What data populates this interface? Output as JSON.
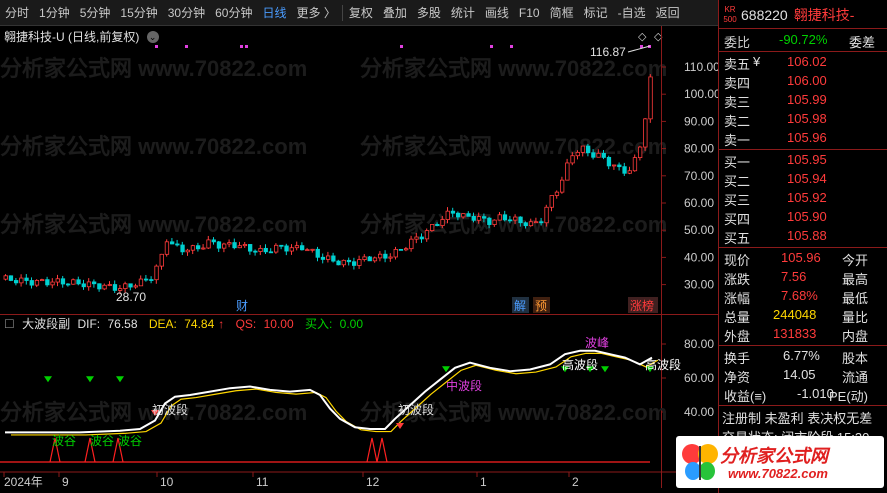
{
  "toolbar": {
    "items": [
      "分时",
      "1分钟",
      "5分钟",
      "15分钟",
      "30分钟",
      "60分钟",
      "日线",
      "更多 〉",
      "复权",
      "叠加",
      "多股",
      "统计",
      "画线",
      "F10",
      "简框",
      "标记",
      "-自选",
      "返回"
    ],
    "active": "日线",
    "corner": "⊞"
  },
  "main": {
    "title": "翱捷科技-U (日线,前复权)",
    "title_icon": "chevron-down-icon",
    "high_label": "116.87",
    "low_label": "28.70",
    "events": [
      "财",
      "解",
      "预",
      "涨榜"
    ],
    "price_ticks": [
      "110.00",
      "100.00",
      "90.00",
      "80.00",
      "70.00",
      "60.00",
      "50.00",
      "40.00",
      "30.00"
    ],
    "watermark": "分析家公式网 www.70822.com"
  },
  "indicator": {
    "name": "大波段副",
    "dif_label": "DIF:",
    "dif_value": "76.58",
    "dea_label": "DEA:",
    "dea_value": "74.84",
    "qs_label": "QS:",
    "qs_value": "10.00",
    "buy_label": "买入:",
    "buy_value": "0.00",
    "ticks": [
      "80.00",
      "60.00",
      "40.00"
    ],
    "annotations": [
      "波谷",
      "波谷",
      "波谷",
      "初波段",
      "初波段",
      "中波段",
      "高波段",
      "高波段",
      "波峰"
    ]
  },
  "xaxis": {
    "labels": [
      "2024年",
      "9",
      "10",
      "11",
      "12",
      "1",
      "2"
    ]
  },
  "quote": {
    "badge_top": "KR",
    "badge_bottom": "500",
    "code": "688220",
    "name": "翱捷科技-",
    "weibi_label": "委比",
    "weibi_value": "-90.72%",
    "weicha_label": "委差",
    "asks": [
      {
        "label": "卖五",
        "price": "106.02",
        "mark": "¥"
      },
      {
        "label": "卖四",
        "price": "106.00"
      },
      {
        "label": "卖三",
        "price": "105.99"
      },
      {
        "label": "卖二",
        "price": "105.98"
      },
      {
        "label": "卖一",
        "price": "105.96"
      }
    ],
    "bids": [
      {
        "label": "买一",
        "price": "105.95"
      },
      {
        "label": "买二",
        "price": "105.94"
      },
      {
        "label": "买三",
        "price": "105.92"
      },
      {
        "label": "买四",
        "price": "105.90"
      },
      {
        "label": "买五",
        "price": "105.88"
      }
    ],
    "stats": [
      {
        "label": "现价",
        "value": "105.96",
        "label2": "今开"
      },
      {
        "label": "涨跌",
        "value": "7.56",
        "label2": "最高"
      },
      {
        "label": "涨幅",
        "value": "7.68%",
        "label2": "最低"
      },
      {
        "label": "总量",
        "value": "244048",
        "label2": "量比"
      },
      {
        "label": "外盘",
        "value": "131833",
        "label2": "内盘"
      }
    ],
    "fin": [
      {
        "label": "换手",
        "value": "6.77%",
        "label2": "股本"
      },
      {
        "label": "净资",
        "value": "14.05",
        "label2": "流通"
      },
      {
        "label": "收益(≡)",
        "value": "-1.010",
        "label2": "PE(动)"
      }
    ],
    "note1": "注册制  未盈利  表决权无差",
    "note2": "交易状态: 闭市阶段 15:30"
  },
  "logo": {
    "text": "分析家公式网",
    "url": "www.70822.com"
  },
  "colors": {
    "up": "#ff3b3b",
    "down": "#00d0d0",
    "axis": "#8b1a1a"
  },
  "chart_data": {
    "type": "candlestick",
    "title": "翱捷科技-U (日线,前复权)",
    "ylim": [
      25,
      118
    ],
    "x_labels": [
      "2024年",
      "9",
      "10",
      "11",
      "12",
      "1",
      "2"
    ],
    "annotated_high": 116.87,
    "annotated_low": 28.7,
    "last_price": 105.96,
    "indicator": {
      "name": "大波段副",
      "DIF": 76.58,
      "DEA": 74.84,
      "QS": 10.0,
      "buy": 0.0,
      "ylim": [
        28,
        90
      ]
    }
  }
}
